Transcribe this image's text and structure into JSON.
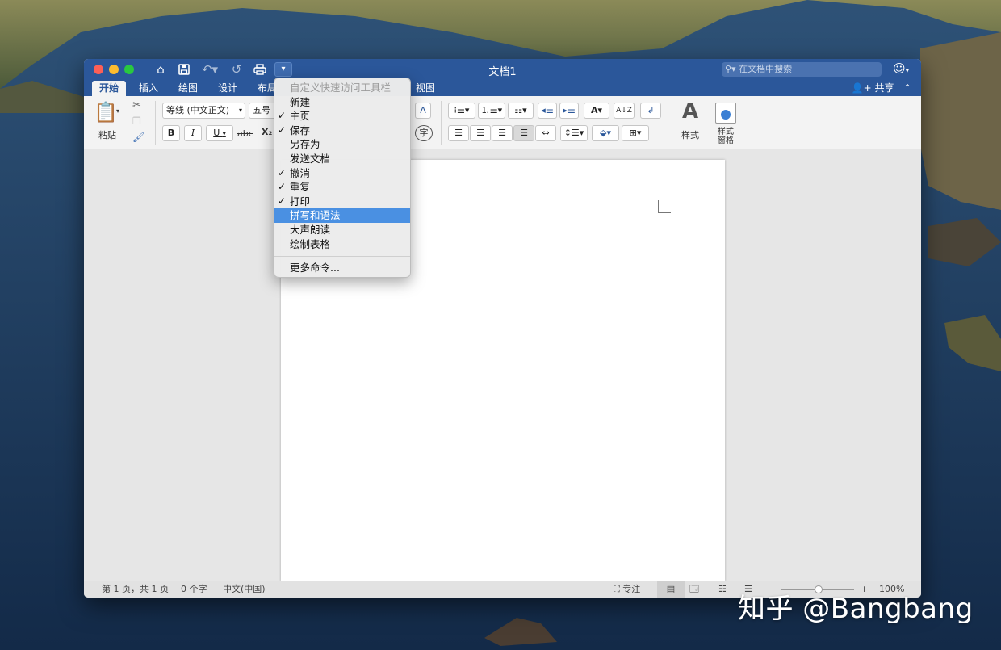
{
  "window": {
    "title": "文档1",
    "search_placeholder": "在文档中搜索",
    "quick_access_more": "▾"
  },
  "tabs": [
    {
      "label": "开始",
      "active": true
    },
    {
      "label": "插入"
    },
    {
      "label": "绘图"
    },
    {
      "label": "设计"
    },
    {
      "label": "布局"
    },
    {
      "label": "视图"
    }
  ],
  "share_label": "共享",
  "ribbon": {
    "paste_label": "粘贴",
    "font_name": "等线 (中文正文)",
    "font_size": "五号",
    "bold": "B",
    "italic": "I",
    "underline": "U",
    "strike": "abc",
    "subscript": "X₂",
    "styles_label": "样式",
    "styles_pane_label_1": "样式",
    "styles_pane_label_2": "窗格",
    "char_box": "A",
    "char_circle": "字"
  },
  "dropdown": {
    "header": "自定义快速访问工具栏",
    "items": [
      {
        "label": "新建",
        "checked": false
      },
      {
        "label": "主页",
        "checked": true
      },
      {
        "label": "保存",
        "checked": true
      },
      {
        "label": "另存为",
        "checked": false
      },
      {
        "label": "发送文档",
        "checked": false
      },
      {
        "label": "撤消",
        "checked": true
      },
      {
        "label": "重复",
        "checked": true
      },
      {
        "label": "打印",
        "checked": true
      },
      {
        "label": "拼写和语法",
        "checked": false,
        "highlighted": true
      },
      {
        "label": "大声朗读",
        "checked": false
      },
      {
        "label": "绘制表格",
        "checked": false
      }
    ],
    "more_commands": "更多命令..."
  },
  "status": {
    "page_info": "第 1 页，共 1 页",
    "word_count": "0 个字",
    "language": "中文(中国)",
    "focus": "专注",
    "zoom": "100%"
  },
  "watermark": "知乎 @Bangbang",
  "colors": {
    "accent": "#2b579a",
    "menu_highlight": "#4a90e2"
  }
}
